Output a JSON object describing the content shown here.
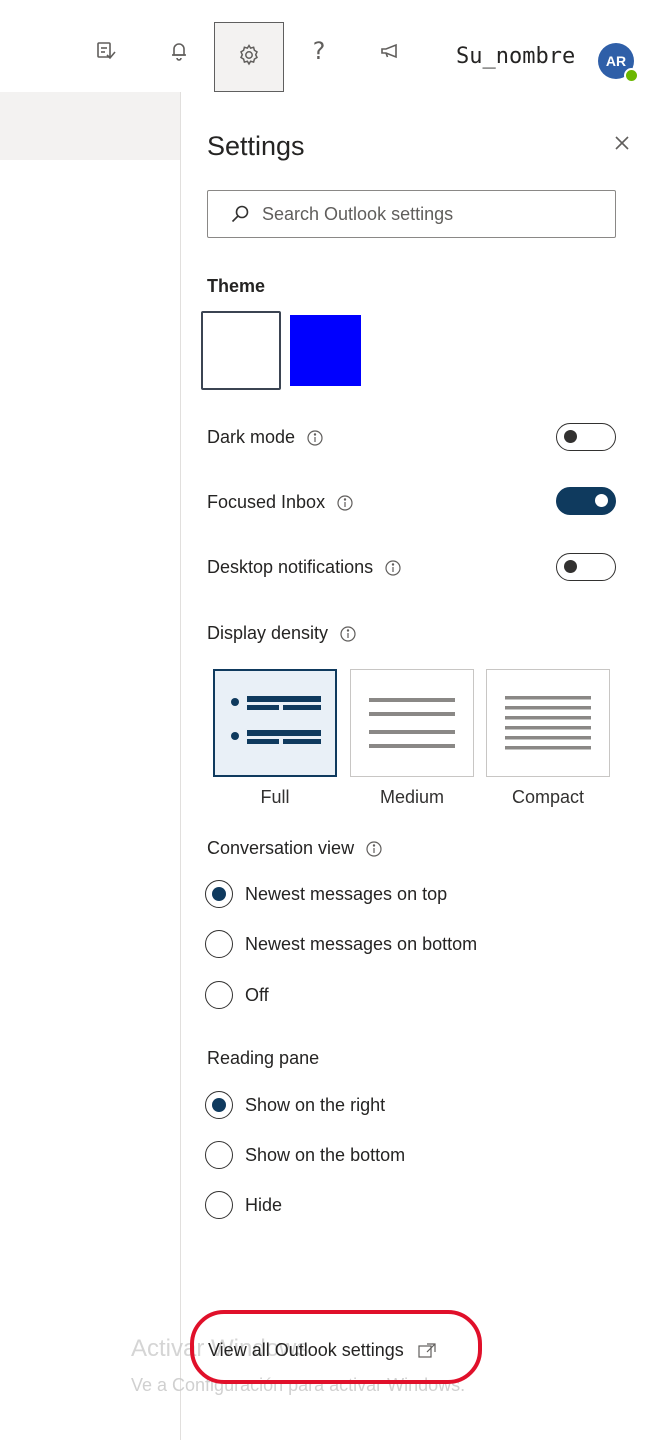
{
  "topbar": {
    "icons": [
      "tasks-icon",
      "bell-icon",
      "gear-icon",
      "help-icon",
      "megaphone-icon"
    ],
    "help_glyph": "?",
    "user_name": "Su_nombre",
    "avatar_initials": "AR"
  },
  "settings": {
    "title": "Settings",
    "search_placeholder": "Search Outlook settings",
    "theme_label": "Theme",
    "theme_swatches": [
      "#ffffff",
      "#0000ff"
    ],
    "dark_mode": {
      "label": "Dark mode",
      "on": false
    },
    "focused_inbox": {
      "label": "Focused Inbox",
      "on": true
    },
    "desktop_notifications": {
      "label": "Desktop notifications",
      "on": false
    },
    "display_density": {
      "label": "Display density",
      "options": [
        "Full",
        "Medium",
        "Compact"
      ],
      "selected": "Full"
    },
    "conversation_view": {
      "label": "Conversation view",
      "options": [
        "Newest messages on top",
        "Newest messages on bottom",
        "Off"
      ],
      "selected": "Newest messages on top"
    },
    "reading_pane": {
      "label": "Reading pane",
      "options": [
        "Show on the right",
        "Show on the bottom",
        "Hide"
      ],
      "selected": "Show on the right"
    },
    "view_all_link": "View all Outlook settings"
  },
  "watermark": {
    "line1": "Activar Windows",
    "line2": "Ve a Configuración para activar Windows."
  },
  "colors": {
    "accent": "#0f3a5e",
    "highlight": "#e0102a",
    "avatar": "#2f5fa8",
    "presence": "#6bb700"
  }
}
